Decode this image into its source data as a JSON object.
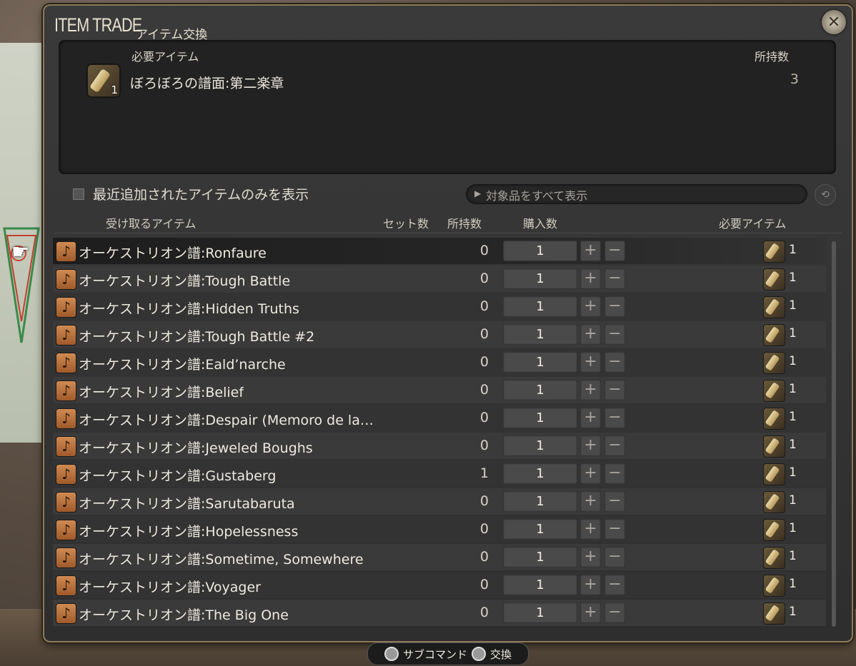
{
  "window": {
    "title": "ITEM TRADE",
    "subtitle": "アイテム交換",
    "close_icon": "close-icon"
  },
  "required": {
    "label": "必要アイテム",
    "owned_label": "所持数",
    "item_name": "ぼろぼろの譜面:第二楽章",
    "item_count": "1",
    "owned": "3"
  },
  "filter": {
    "checkbox_label": "最近追加されたアイテムのみを表示",
    "dropdown_text": "対象品をすべて表示"
  },
  "columns": {
    "receive": "受け取るアイテム",
    "set_count": "セット数",
    "owned": "所持数",
    "purchase": "購入数",
    "required": "必要アイテム"
  },
  "rows": [
    {
      "name": "オーケストリオン譜:Ronfaure",
      "owned": "0",
      "qty": "1",
      "req": "1"
    },
    {
      "name": "オーケストリオン譜:Tough Battle",
      "owned": "0",
      "qty": "1",
      "req": "1"
    },
    {
      "name": "オーケストリオン譜:Hidden Truths",
      "owned": "0",
      "qty": "1",
      "req": "1"
    },
    {
      "name": "オーケストリオン譜:Tough Battle #2",
      "owned": "0",
      "qty": "1",
      "req": "1"
    },
    {
      "name": "オーケストリオン譜:Eald’narche",
      "owned": "0",
      "qty": "1",
      "req": "1"
    },
    {
      "name": "オーケストリオン譜:Belief",
      "owned": "0",
      "qty": "1",
      "req": "1"
    },
    {
      "name": "オーケストリオン譜:Despair (Memoro de la…",
      "owned": "0",
      "qty": "1",
      "req": "1"
    },
    {
      "name": "オーケストリオン譜:Jeweled Boughs",
      "owned": "0",
      "qty": "1",
      "req": "1"
    },
    {
      "name": "オーケストリオン譜:Gustaberg",
      "owned": "1",
      "qty": "1",
      "req": "1"
    },
    {
      "name": "オーケストリオン譜:Sarutabaruta",
      "owned": "0",
      "qty": "1",
      "req": "1"
    },
    {
      "name": "オーケストリオン譜:Hopelessness",
      "owned": "0",
      "qty": "1",
      "req": "1"
    },
    {
      "name": "オーケストリオン譜:Sometime, Somewhere",
      "owned": "0",
      "qty": "1",
      "req": "1"
    },
    {
      "name": "オーケストリオン譜:Voyager",
      "owned": "0",
      "qty": "1",
      "req": "1"
    },
    {
      "name": "オーケストリオン譜:The Big One",
      "owned": "0",
      "qty": "1",
      "req": "1"
    }
  ],
  "footer": {
    "subcommand": "サブコマンド",
    "exchange": "交換"
  }
}
